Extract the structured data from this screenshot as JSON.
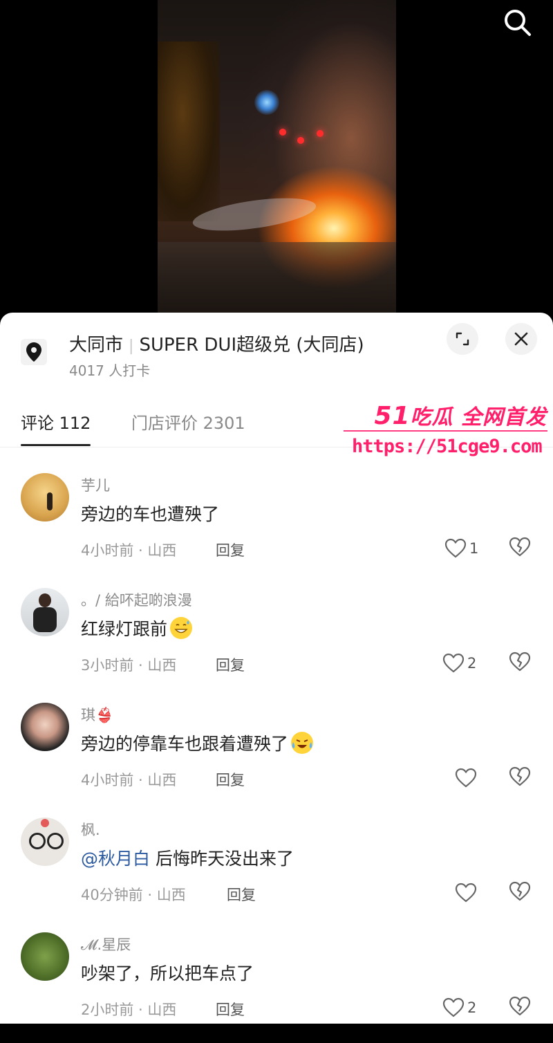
{
  "location": {
    "city": "大同市",
    "store": "SUPER DUI超级兑 (大同店)",
    "checkins": "4017 人打卡"
  },
  "tabs": [
    {
      "label": "评论 112"
    },
    {
      "label": "门店评价 2301"
    }
  ],
  "watermark": {
    "line1_num": "51",
    "line1_text": "吃瓜 全网首发",
    "url": "https://51cge9.com"
  },
  "reply_label": "回复",
  "comments": [
    {
      "name": "芋儿",
      "text": "旁边的车也遭殃了",
      "meta": "4小时前 · 山西",
      "likes": "1"
    },
    {
      "name": "。/ 給吥起啲浪漫",
      "text": "红绿灯跟前",
      "meta": "3小时前 · 山西",
      "likes": "2"
    },
    {
      "name": "琪👙",
      "text": "旁边的停靠车也跟着遭殃了",
      "meta": "4小时前 · 山西",
      "likes": ""
    },
    {
      "name": "枫.",
      "mention": "@秋月白",
      "text": "后悔昨天没出来了",
      "meta": "40分钟前 · 山西",
      "likes": ""
    },
    {
      "name": "𝓜.星辰",
      "text": "吵架了，所以把车点了",
      "meta": "2小时前 · 山西",
      "likes": "2"
    }
  ],
  "colors": {
    "watermark": "#ff1f6a",
    "mention": "#2c5aa0"
  }
}
